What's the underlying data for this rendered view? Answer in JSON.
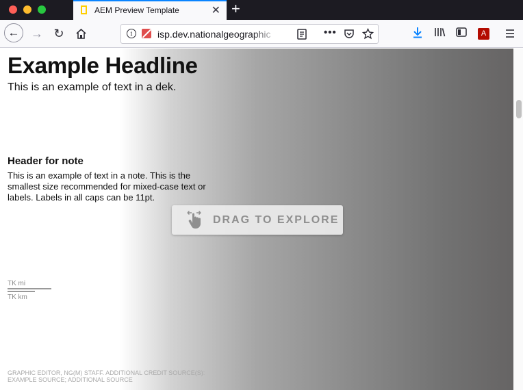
{
  "window": {
    "tab_title": "AEM Preview Template",
    "new_tab_symbol": "+",
    "tab_close_symbol": "✕"
  },
  "navigation": {
    "url_text": "isp.dev.nationalgeographic",
    "back_icon": "arrow-left-icon",
    "forward_icon": "arrow-right-icon",
    "reload_icon": "reload-icon",
    "home_icon": "home-icon",
    "more_symbol": "•••"
  },
  "content": {
    "headline": "Example Headline",
    "dek": "This is an example of text in a dek.",
    "note_header": "Header for note",
    "note_text": "This is an example of text in a note. This is the smallest size recommended for mixed-case text or labels. Labels in all caps can be 11pt.",
    "drag_label": "DRAG TO EXPLORE",
    "scale_mi": "TK mi",
    "scale_km": "TK km",
    "credit": "GRAPHIC EDITOR, NG(M) STAFF. ADDITIONAL CREDIT SOURCE(S): EXAMPLE SOURCE; ADDITIONAL SOURCE"
  },
  "colors": {
    "tab_accent": "#0a84ff",
    "favicon": "#ffce00",
    "download_icon": "#0a84ff",
    "acrobat": "#b30b00"
  }
}
